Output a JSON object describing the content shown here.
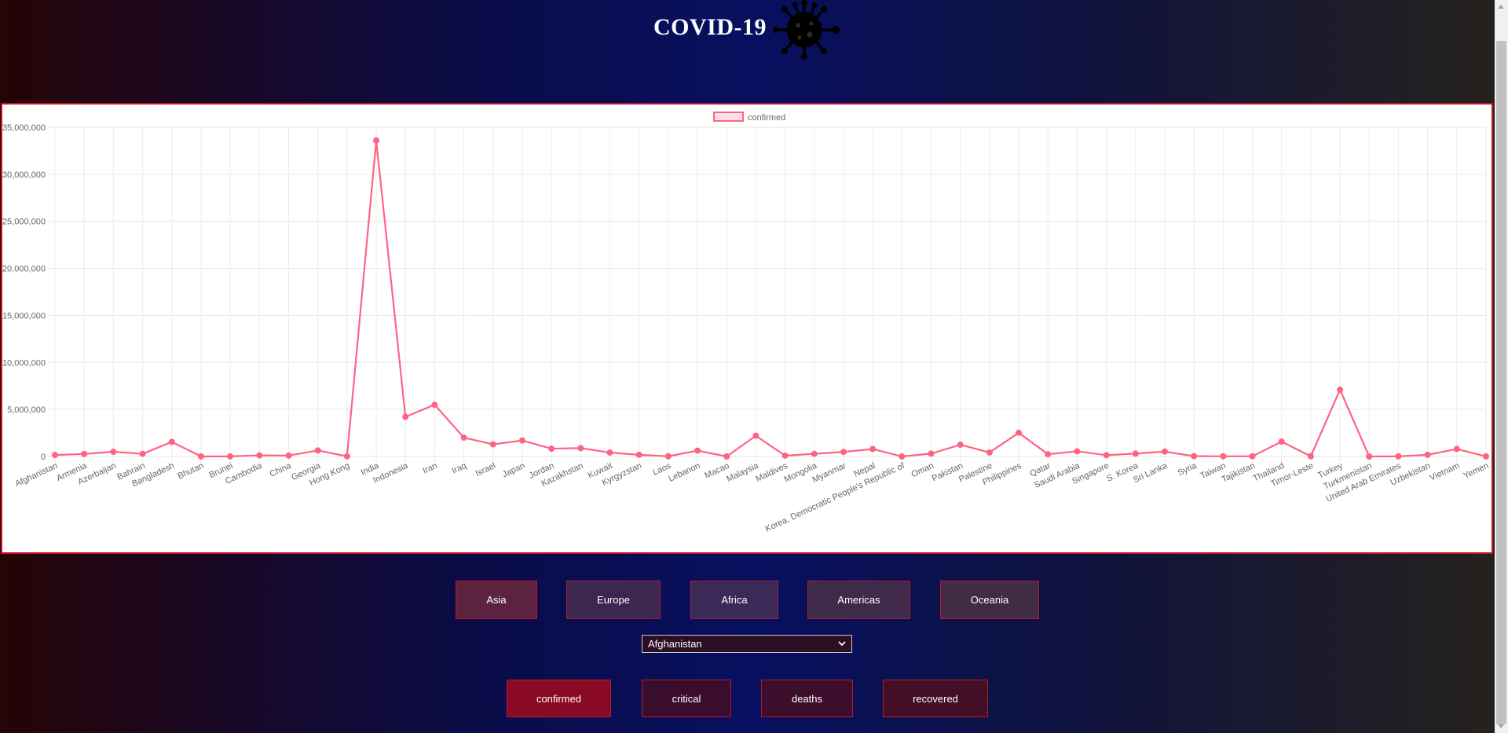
{
  "header": {
    "title": "COVID-19",
    "logo_icon": "virus-icon"
  },
  "chart_data": {
    "type": "line",
    "legend": [
      "confirmed"
    ],
    "legend_position": "top-center",
    "grid": true,
    "line_color": "#ff6384",
    "ylim": [
      0,
      35000000
    ],
    "y_ticks": [
      "0",
      "5,000,000",
      "10,000,000",
      "15,000,000",
      "20,000,000",
      "25,000,000",
      "30,000,000",
      "35,000,000"
    ],
    "categories": [
      "Afghanistan",
      "Armenia",
      "Azerbaijan",
      "Bahrain",
      "Bangladesh",
      "Bhutan",
      "Brunei",
      "Cambodia",
      "China",
      "Georgia",
      "Hong Kong",
      "India",
      "Indonesia",
      "Iran",
      "Iraq",
      "Israel",
      "Japan",
      "Jordan",
      "Kazakhstan",
      "Kuwait",
      "Kyrgyzstan",
      "Laos",
      "Lebanon",
      "Macao",
      "Malaysia",
      "Maldives",
      "Mongolia",
      "Myanmar",
      "Nepal",
      "Korea, Democratic People's Republic of",
      "Oman",
      "Pakistan",
      "Palestine",
      "Philippines",
      "Qatar",
      "Saudi Arabia",
      "Singapore",
      "S. Korea",
      "Sri Lanka",
      "Syria",
      "Taiwan",
      "Tajikistan",
      "Thailand",
      "Timor-Leste",
      "Turkey",
      "Turkmenistan",
      "United Arab Emirates",
      "Uzbekistan",
      "Vietnam",
      "Yemen"
    ],
    "series": [
      {
        "name": "confirmed",
        "values": [
          155000,
          265000,
          500000,
          275000,
          1550000,
          2600,
          8000,
          115000,
          96000,
          640000,
          12000,
          33600000,
          4210000,
          5500000,
          2000000,
          1290000,
          1700000,
          830000,
          890000,
          410000,
          180000,
          20000,
          620000,
          80,
          2200000,
          85000,
          280000,
          480000,
          790000,
          0,
          303000,
          1250000,
          420000,
          2520000,
          235000,
          546000,
          140000,
          300000,
          520000,
          30000,
          16000,
          17000,
          1580000,
          20000,
          7100000,
          0,
          10000,
          178000,
          790000,
          9000
        ]
      }
    ]
  },
  "regions": {
    "options": [
      {
        "label": "Asia",
        "color": "#5e2241"
      },
      {
        "label": "Europe",
        "color": "#3d2650"
      },
      {
        "label": "Africa",
        "color": "#3b2a58"
      },
      {
        "label": "Americas",
        "color": "#3f2a4a"
      },
      {
        "label": "Oceania",
        "color": "#412b45"
      }
    ]
  },
  "country_select": {
    "value": "Afghanistan"
  },
  "metrics": {
    "options": [
      {
        "label": "confirmed",
        "color": "#8a0a26"
      },
      {
        "label": "critical",
        "color": "#3a0d2f"
      },
      {
        "label": "deaths",
        "color": "#3d0e2b"
      },
      {
        "label": "recovered",
        "color": "#430f27"
      }
    ]
  }
}
